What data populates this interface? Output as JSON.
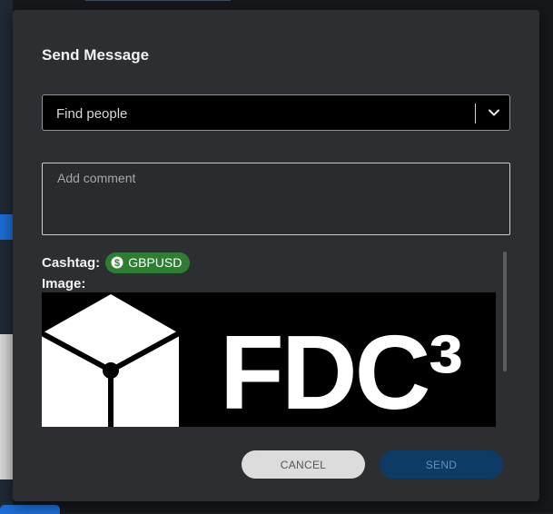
{
  "modal": {
    "title": "Send Message"
  },
  "people_select": {
    "placeholder": "Find people",
    "icon": "chevron-down-icon"
  },
  "comment": {
    "placeholder": "Add comment",
    "value": ""
  },
  "cashtag": {
    "label": "Cashtag:",
    "value": "GBPUSD",
    "icon": "dollar-circle-icon",
    "color": "#2e7d32"
  },
  "image": {
    "label": "Image:",
    "logo_text": "FDC³"
  },
  "actions": {
    "cancel_label": "CANCEL",
    "send_label": "SEND"
  },
  "colors": {
    "modal_bg": "#2d2e31",
    "send_button": "#0d3b66",
    "cancel_button": "#dcdcdc"
  }
}
